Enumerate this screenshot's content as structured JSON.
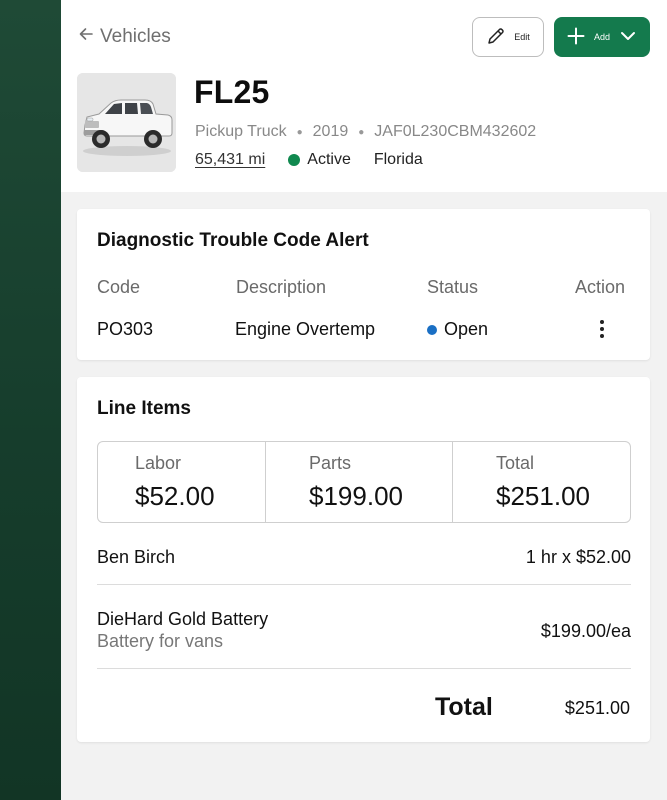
{
  "header": {
    "back_label": "Vehicles",
    "edit_label": "Edit",
    "add_label": "Add"
  },
  "vehicle": {
    "name": "FL25",
    "type": "Pickup Truck",
    "year": "2019",
    "vin": "JAF0L230CBM432602",
    "mileage": "65,431 mi",
    "status": "Active",
    "location": "Florida",
    "status_color": "#10894f"
  },
  "dtc": {
    "title": "Diagnostic Trouble Code Alert",
    "columns": [
      "Code",
      "Description",
      "Status",
      "Action"
    ],
    "rows": [
      {
        "code": "PO303",
        "description": "Engine Overtemp",
        "status": "Open",
        "status_color": "#1a6fc4"
      }
    ]
  },
  "line_items": {
    "title": "Line Items",
    "summary": [
      {
        "label": "Labor",
        "value": "$52.00"
      },
      {
        "label": "Parts",
        "value": "$199.00"
      },
      {
        "label": "Total",
        "value": "$251.00"
      }
    ],
    "items": [
      {
        "name": "Ben Birch",
        "detail": "",
        "amount": "1 hr x $52.00"
      },
      {
        "name": "DieHard Gold Battery",
        "detail": "Battery for vans",
        "amount": "$199.00/ea"
      }
    ],
    "total_label": "Total",
    "total_value": "$251.00"
  },
  "colors": {
    "sidebar": "#1a4431",
    "primary_button": "#147a4d"
  }
}
